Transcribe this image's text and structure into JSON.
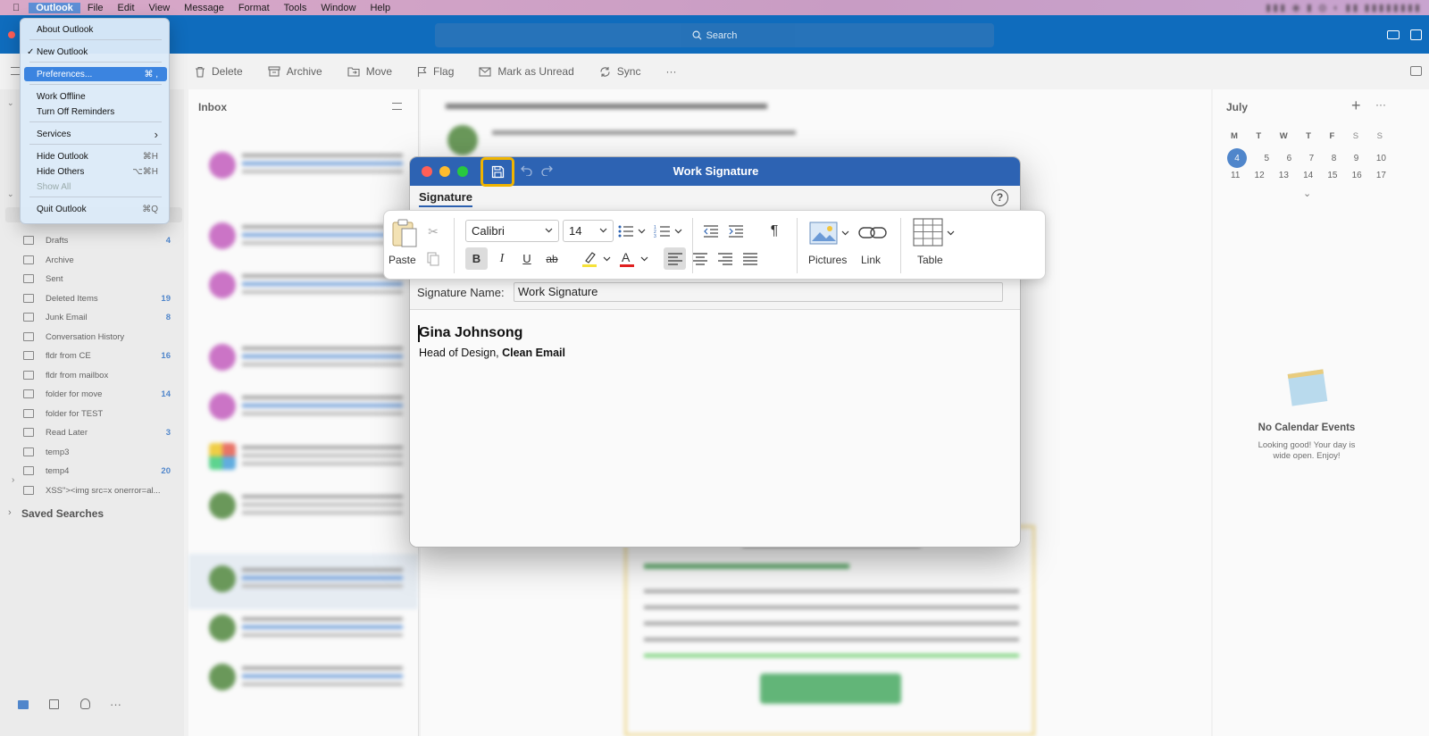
{
  "menubar": {
    "items": [
      "Outlook",
      "File",
      "Edit",
      "View",
      "Message",
      "Format",
      "Tools",
      "Window",
      "Help"
    ],
    "active": "Outlook"
  },
  "app_menu": {
    "items": [
      {
        "label": "About Outlook",
        "shortcut": "",
        "check": "",
        "state": "normal"
      },
      {
        "label": "New Outlook",
        "shortcut": "",
        "check": "✓",
        "state": "normal"
      },
      {
        "label": "Preferences...",
        "shortcut": "⌘ ,",
        "check": "",
        "state": "selected"
      },
      {
        "label": "Work Offline",
        "shortcut": "",
        "check": "",
        "state": "normal"
      },
      {
        "label": "Turn Off Reminders",
        "shortcut": "",
        "check": "",
        "state": "normal"
      },
      {
        "label": "Services",
        "shortcut": "›",
        "check": "",
        "state": "normal"
      },
      {
        "label": "Hide Outlook",
        "shortcut": "⌘H",
        "check": "",
        "state": "normal"
      },
      {
        "label": "Hide Others",
        "shortcut": "⌥⌘H",
        "check": "",
        "state": "normal"
      },
      {
        "label": "Show All",
        "shortcut": "",
        "check": "",
        "state": "disabled"
      },
      {
        "label": "Quit Outlook",
        "shortcut": "⌘Q",
        "check": "",
        "state": "normal"
      }
    ]
  },
  "header": {
    "search_label": "Search"
  },
  "toolbar": {
    "delete": "Delete",
    "archive": "Archive",
    "move": "Move",
    "flag": "Flag",
    "mark_unread": "Mark as Unread",
    "sync": "Sync",
    "more": "···"
  },
  "sidebar": {
    "folders": [
      {
        "label": "Drafts",
        "count": "4"
      },
      {
        "label": "Archive",
        "count": ""
      },
      {
        "label": "Sent",
        "count": ""
      },
      {
        "label": "Deleted Items",
        "count": "19"
      },
      {
        "label": "Junk Email",
        "count": "8"
      },
      {
        "label": "Conversation History",
        "count": ""
      },
      {
        "label": "fldr from CE",
        "count": "16"
      },
      {
        "label": "fldr from mailbox",
        "count": ""
      },
      {
        "label": "folder for move",
        "count": "14"
      },
      {
        "label": "folder for TEST",
        "count": ""
      },
      {
        "label": "Read Later",
        "count": "3"
      },
      {
        "label": "temp3",
        "count": ""
      },
      {
        "label": "temp4",
        "count": "20"
      },
      {
        "label": "XSS\"><img src=x onerror=al...",
        "count": ""
      }
    ],
    "saved_searches": "Saved Searches"
  },
  "inbox": {
    "title": "Inbox"
  },
  "calendar": {
    "month": "July",
    "weekdays": [
      "M",
      "T",
      "W",
      "T",
      "F",
      "S",
      "S"
    ],
    "week1": [
      "4",
      "5",
      "6",
      "7",
      "8",
      "9",
      "10"
    ],
    "week2": [
      "11",
      "12",
      "13",
      "14",
      "15",
      "16",
      "17"
    ],
    "today": "4",
    "empty_title": "No Calendar Events",
    "empty_text": "Looking good! Your day is wide open. Enjoy!"
  },
  "dialog": {
    "title": "Work Signature",
    "tab": "Signature",
    "help": "?",
    "ribbon": {
      "paste": "Paste",
      "font": "Calibri",
      "size": "14",
      "pictures": "Pictures",
      "link": "Link",
      "table": "Table"
    },
    "name_label": "Signature Name:",
    "name_value": "Work Signature",
    "sig_name": "Gina Johnsong",
    "sig_role": "Head of Design, ",
    "sig_company": "Clean Email"
  },
  "colors": {
    "accent": "#0f6cbd",
    "dialog_title": "#2d63b3",
    "highlight_box": "#f0b400",
    "menu_selected": "#3b84e0"
  }
}
